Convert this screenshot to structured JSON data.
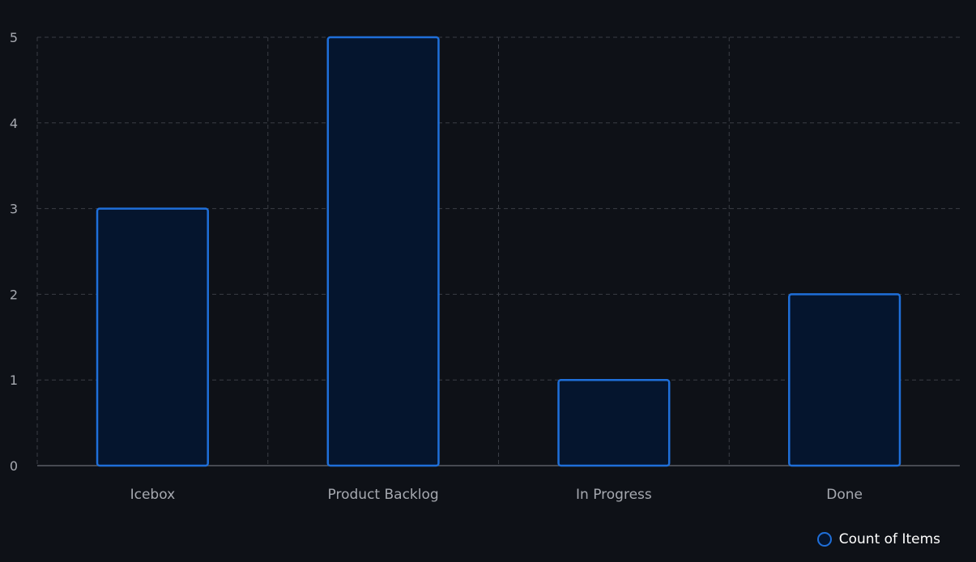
{
  "chart_data": {
    "type": "bar",
    "categories": [
      "Icebox",
      "Product Backlog",
      "In Progress",
      "Done"
    ],
    "series": [
      {
        "name": "Count of Items",
        "values": [
          3,
          5,
          1,
          2
        ]
      }
    ],
    "title": "",
    "xlabel": "",
    "ylabel": "",
    "ylim": [
      0,
      5
    ],
    "yticks": [
      "0",
      "1",
      "2",
      "3",
      "4",
      "5"
    ],
    "grid": true,
    "legend_position": "bottom-right",
    "colors": {
      "background": "#0e1117",
      "bar_fill": "#05152e",
      "bar_stroke": "#1f6fd9",
      "grid": "#3a3d45",
      "axis": "#5a5d66",
      "tick_text": "#a6a9b0",
      "legend_text": "#ffffff"
    }
  }
}
